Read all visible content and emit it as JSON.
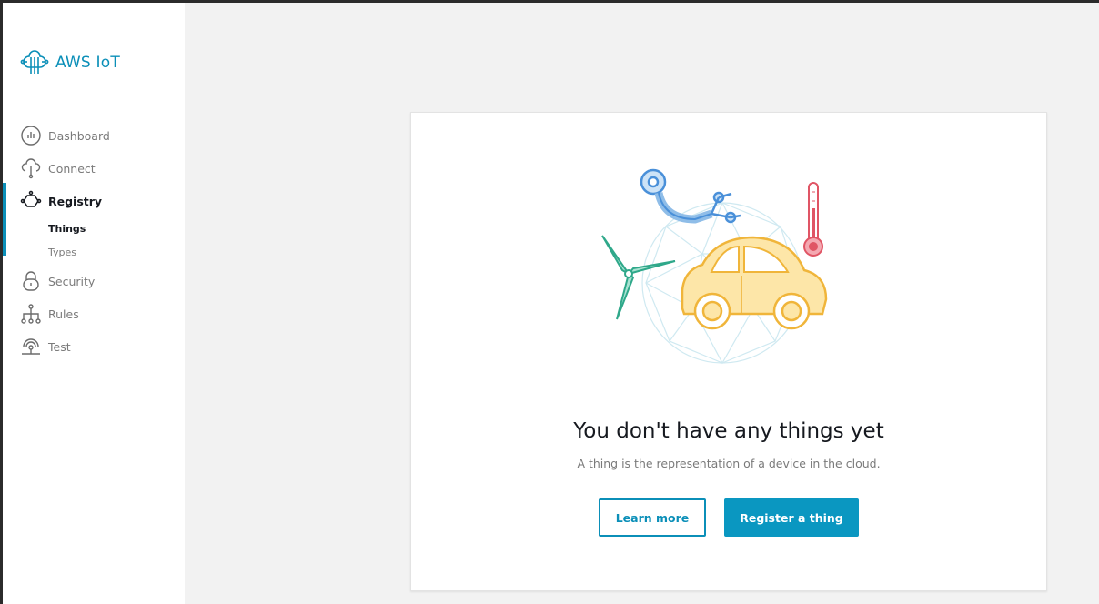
{
  "brand": {
    "name": "AWS IoT",
    "color": "#0b8fb8"
  },
  "sidebar": {
    "items": [
      {
        "label": "Dashboard",
        "icon": "dashboard-icon"
      },
      {
        "label": "Connect",
        "icon": "cloud-connect-icon"
      },
      {
        "label": "Registry",
        "icon": "registry-icon",
        "active": true
      },
      {
        "label": "Security",
        "icon": "lock-icon"
      },
      {
        "label": "Rules",
        "icon": "rules-tree-icon"
      },
      {
        "label": "Test",
        "icon": "signal-test-icon"
      }
    ],
    "registry_sub": [
      {
        "label": "Things",
        "active": true
      },
      {
        "label": "Types"
      }
    ]
  },
  "empty_state": {
    "title": "You don't have any things yet",
    "description": "A thing is the representation of a device in the cloud.",
    "learn_more_label": "Learn more",
    "register_label": "Register a thing"
  },
  "colors": {
    "accent": "#0b8fb8",
    "primary_button": "#0a97c1",
    "background": "#f2f2f2"
  }
}
